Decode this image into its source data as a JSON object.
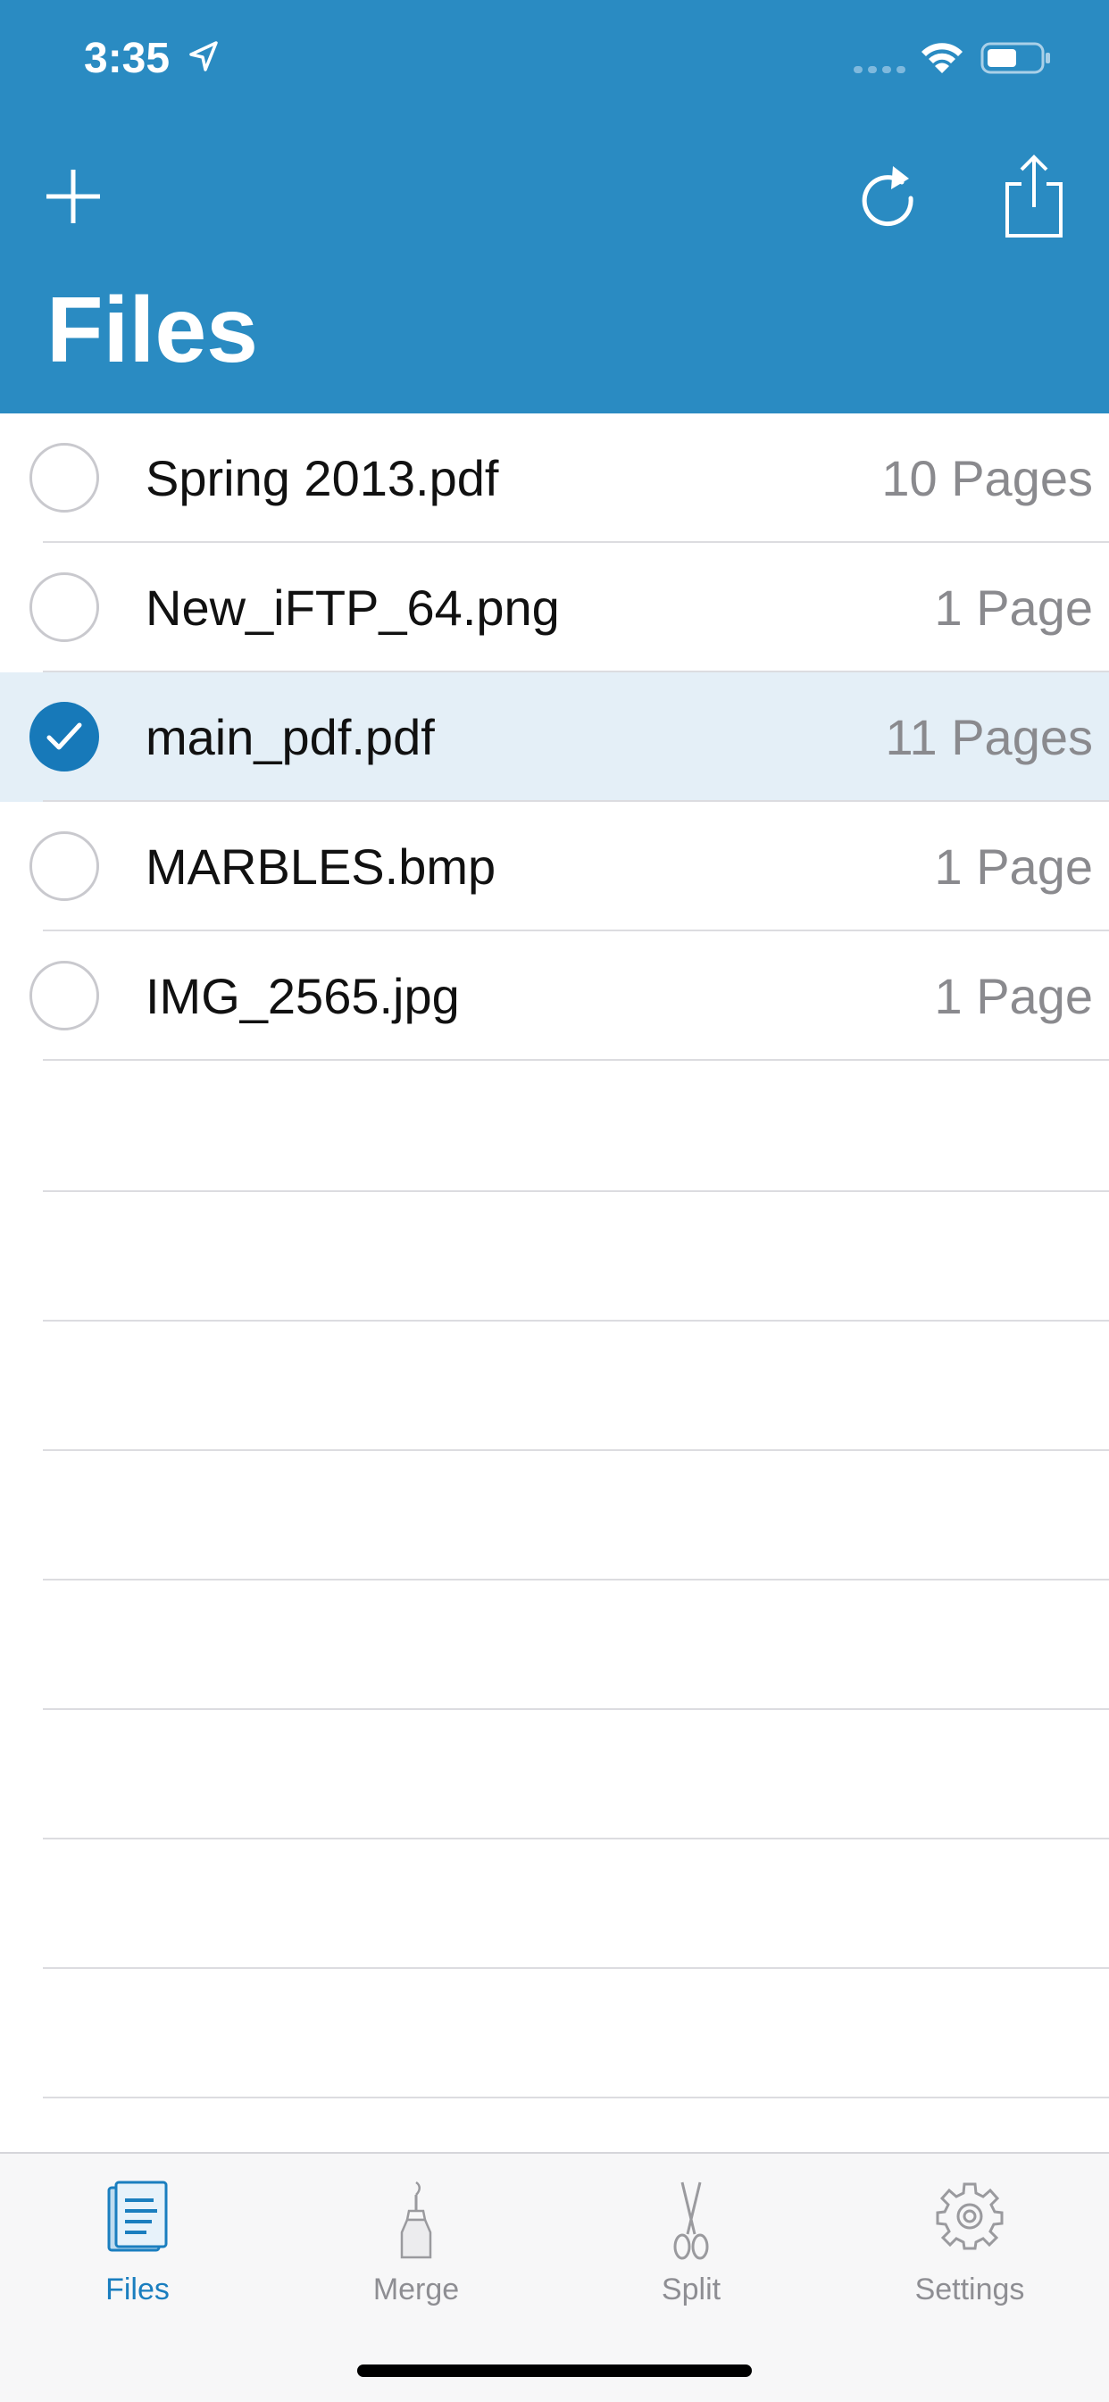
{
  "status_bar": {
    "time": "3:35"
  },
  "nav": {
    "title": "Files"
  },
  "files": [
    {
      "name": "Spring 2013.pdf",
      "pages": "10 Pages",
      "selected": false
    },
    {
      "name": "New_iFTP_64.png",
      "pages": "1 Page",
      "selected": false
    },
    {
      "name": "main_pdf.pdf",
      "pages": "11 Pages",
      "selected": true
    },
    {
      "name": "MARBLES.bmp",
      "pages": "1 Page",
      "selected": false
    },
    {
      "name": "IMG_2565.jpg",
      "pages": "1 Page",
      "selected": false
    }
  ],
  "tabs": [
    {
      "label": "Files",
      "icon": "files-icon",
      "active": true
    },
    {
      "label": "Merge",
      "icon": "glue-bottle-icon",
      "active": false
    },
    {
      "label": "Split",
      "icon": "scissors-icon",
      "active": false
    },
    {
      "label": "Settings",
      "icon": "gear-icon",
      "active": false
    }
  ],
  "colors": {
    "header": "#2A8BC2",
    "accent": "#1779B9",
    "selected_row": "#E4EFF7",
    "secondary_text": "#8A8A8E"
  }
}
